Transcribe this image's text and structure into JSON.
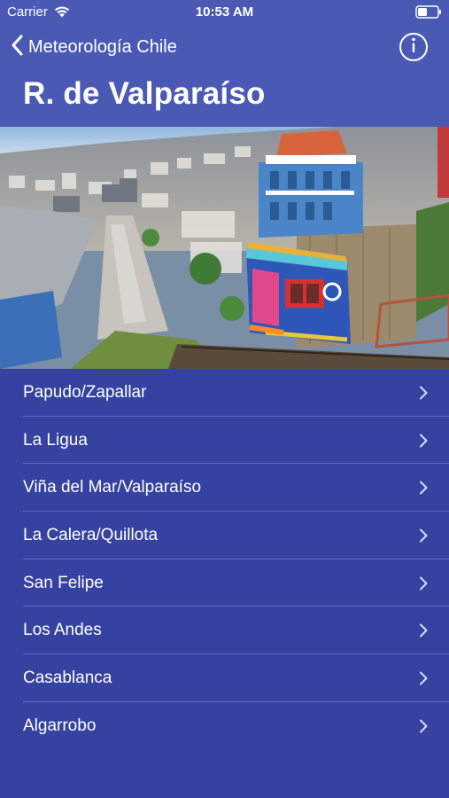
{
  "status_bar": {
    "carrier": "Carrier",
    "time": "10:53 AM",
    "icons": [
      "wifi-icon",
      "battery-icon"
    ]
  },
  "nav": {
    "back_label": "Meteorología Chile",
    "back_icon": "chevron-left-icon",
    "info_icon": "info-icon",
    "title": "R. de Valparaíso"
  },
  "hero": {
    "image": "photo of a colorful funicular car on a hillside above the city and port of Valparaíso"
  },
  "regions": [
    {
      "label": "Papudo/Zapallar"
    },
    {
      "label": "La Ligua"
    },
    {
      "label": "Viña del Mar/Valparaíso"
    },
    {
      "label": "La Calera/Quillota"
    },
    {
      "label": "San Felipe"
    },
    {
      "label": "Los Andes"
    },
    {
      "label": "Casablanca"
    },
    {
      "label": "Algarrobo"
    }
  ],
  "colors": {
    "header_bg": "#4a5ab4",
    "list_bg": "#3642a0",
    "separator": "#5e6ab9",
    "text": "#ffffff"
  }
}
